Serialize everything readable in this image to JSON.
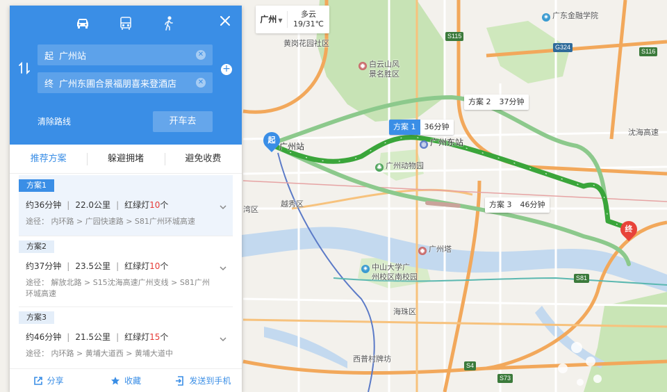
{
  "weather": {
    "city": "广州",
    "condition": "多云",
    "temp": "19/31℃"
  },
  "map": {
    "labels": {
      "huagang": "黄岗花园社区",
      "baiyunshan": "白云山风\n景名胜区",
      "gz_station": "广州站",
      "gz_east": "广州东站",
      "zoo": "广州动物园",
      "yuexiu": "越秀区",
      "tower": "广州塔",
      "sysu": "中山大学广\n州校区南校园",
      "haizhu": "海珠区",
      "xicun": "西普村牌坊",
      "finance": "广东金融学院",
      "shenhai": "沈海高速",
      "liwan": "湾区"
    },
    "shields": {
      "s115": "S115",
      "g324": "G324",
      "s116": "S116",
      "s81": "S81",
      "s4": "S4",
      "s73": "S73"
    },
    "route_tags": [
      {
        "name": "方案 1",
        "time": "36分钟"
      },
      {
        "name": "方案 2",
        "time": "37分钟"
      },
      {
        "name": "方案 3",
        "time": "46分钟"
      }
    ],
    "start_marker": "起",
    "end_marker": "终"
  },
  "panel": {
    "origin_prefix": "起",
    "origin": "广州站",
    "destination_prefix": "终",
    "destination": "广州东圃合景福朋喜来登酒店",
    "clear_route": "清除路线",
    "drive": "开车去",
    "tabs": [
      "推荐方案",
      "躲避拥堵",
      "避免收费"
    ],
    "plans": [
      {
        "tag": "方案1",
        "time": "约36分钟",
        "distance": "22.0公里",
        "lights_label": "红绿灯",
        "lights": "10",
        "lights_unit": "个",
        "via": "途径：  内环路 > 广园快速路 > S81广州环城高速"
      },
      {
        "tag": "方案2",
        "time": "约37分钟",
        "distance": "23.5公里",
        "lights_label": "红绿灯",
        "lights": "10",
        "lights_unit": "个",
        "via": "途径：  解放北路 > S15沈海高速广州支线 > S81广州环城高速"
      },
      {
        "tag": "方案3",
        "time": "约46分钟",
        "distance": "21.5公里",
        "lights_label": "红绿灯",
        "lights": "15",
        "lights_unit": "个",
        "via": "途径：  内环路 > 黄埔大道西 > 黄埔大道中"
      }
    ],
    "actions": {
      "share": "分享",
      "favorite": "收藏",
      "send": "发送到手机"
    }
  },
  "colors": {
    "accent": "#3a8ee6",
    "route_active": "#3aa53a",
    "route_alt": "#8cc98c",
    "green_area": "#c7e3b5",
    "water": "#c3d9ef",
    "highway": "#f2a85b",
    "end_marker": "#e8433a"
  }
}
